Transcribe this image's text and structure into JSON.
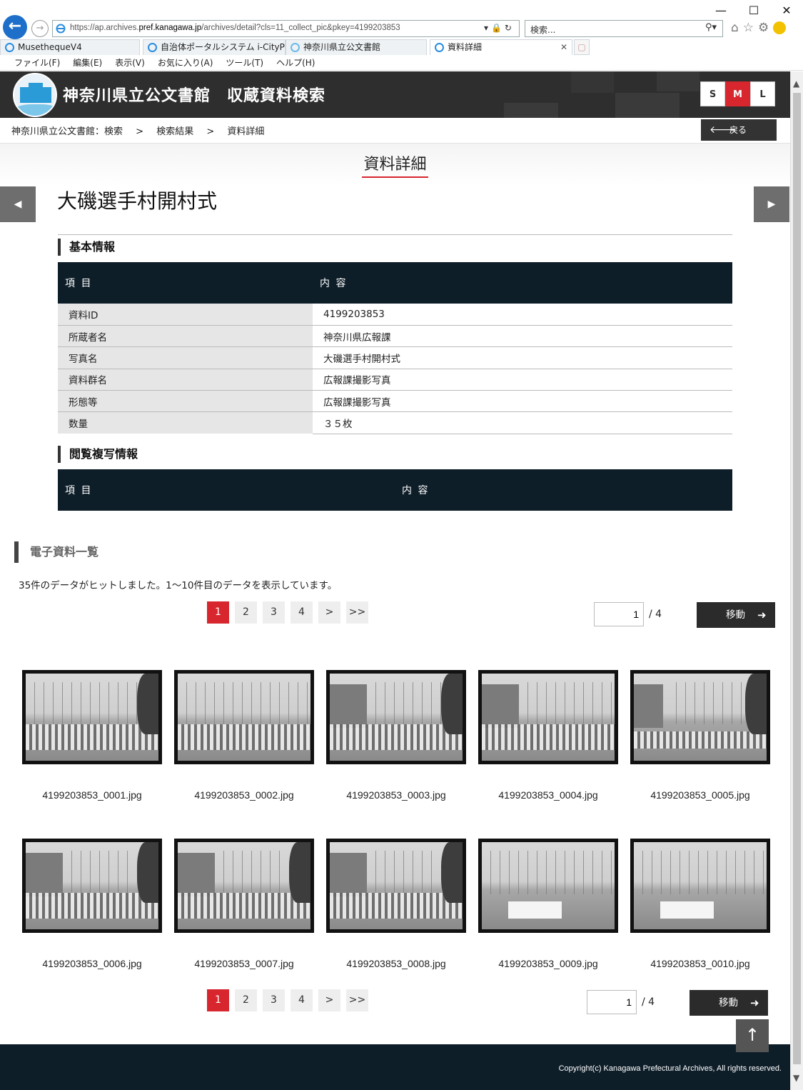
{
  "browser": {
    "window_controls": [
      "—",
      "☐",
      "✕"
    ],
    "url_host_pre": "https://ap.archives.",
    "url_host": "pref.kanagawa.jp",
    "url_path": "/archives/detail?cls=11_collect_pic&pkey=4199203853",
    "search_placeholder": "検索...",
    "tabs": [
      {
        "label": "MusethequeV4",
        "active": false
      },
      {
        "label": "自治体ポータルシステム i-CityPortal",
        "active": false
      },
      {
        "label": "神奈川県立公文書館",
        "active": false
      },
      {
        "label": "資料詳細",
        "active": true
      }
    ],
    "menu": [
      "ファイル(F)",
      "編集(E)",
      "表示(V)",
      "お気に入り(A)",
      "ツール(T)",
      "ヘルプ(H)"
    ]
  },
  "header": {
    "site_title": "神奈川県立公文書館　収蔵資料検索",
    "font_sizes": [
      "S",
      "M",
      "L"
    ],
    "font_size_selected": "M"
  },
  "breadcrumb": {
    "items": [
      "神奈川県立公文書館：検索",
      ">",
      "検索結果",
      ">",
      "資料詳細"
    ],
    "back_label": "戻る"
  },
  "page_heading": "資料詳細",
  "document_title": "大磯選手村開村式",
  "basic_info": {
    "section_title": "基本情報",
    "col_item": "項 目",
    "col_content": "内 容",
    "rows": [
      {
        "key": "資料ID",
        "value": "4199203853"
      },
      {
        "key": "所蔵者名",
        "value": "神奈川県広報課"
      },
      {
        "key": "写真名",
        "value": "大磯選手村開村式"
      },
      {
        "key": "資料群名",
        "value": "広報課撮影写真"
      },
      {
        "key": "形態等",
        "value": "広報課撮影写真"
      },
      {
        "key": "数量",
        "value": "３５枚"
      }
    ]
  },
  "copy_info": {
    "section_title": "閲覧複写情報",
    "col_item": "項 目",
    "col_content": "内 容"
  },
  "digital_list": {
    "section_title": "電子資料一覧",
    "hit_message": "35件のデータがヒットしました。1～10件目のデータを表示しています。",
    "pages": [
      "1",
      "2",
      "3",
      "4",
      ">",
      ">>"
    ],
    "current_page": "1",
    "page_input": "1",
    "total_pages": "/ 4",
    "move_label": "移動",
    "files": [
      "4199203853_0001.jpg",
      "4199203853_0002.jpg",
      "4199203853_0003.jpg",
      "4199203853_0004.jpg",
      "4199203853_0005.jpg",
      "4199203853_0006.jpg",
      "4199203853_0007.jpg",
      "4199203853_0008.jpg",
      "4199203853_0009.jpg",
      "4199203853_0010.jpg"
    ]
  },
  "footer": {
    "copyright": "Copyright(c) Kanagawa Prefectural Archives, All rights reserved."
  },
  "colors": {
    "accent_red": "#d7262e",
    "header_dark": "#2e2e2e",
    "table_header": "#0e1e29"
  }
}
